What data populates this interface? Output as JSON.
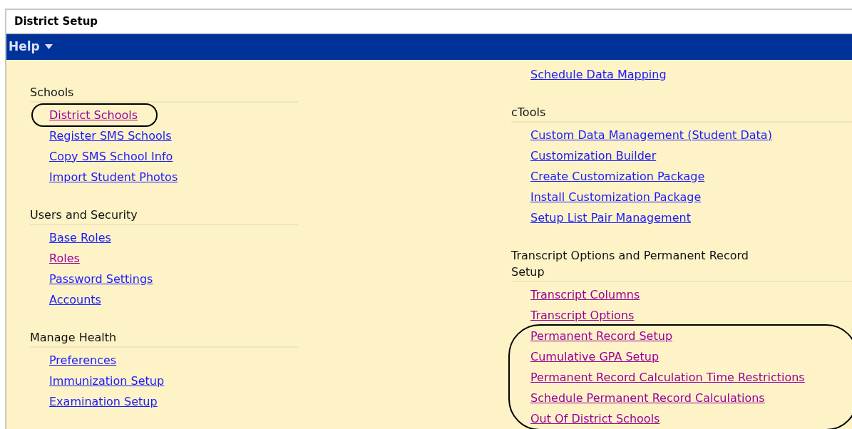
{
  "window": {
    "title": "District Setup"
  },
  "menu_bar": {
    "items": [
      {
        "label": "Help",
        "has_dropdown": true
      }
    ]
  },
  "columns": [
    {
      "sections": [
        {
          "title": "Schools",
          "items": [
            {
              "kind": "circled",
              "links": [
                {
                  "label": "District Schools",
                  "visited": true
                }
              ]
            },
            {
              "kind": "link",
              "label": "Register SMS Schools",
              "visited": false
            },
            {
              "kind": "link",
              "label": "Copy SMS School Info",
              "visited": false
            },
            {
              "kind": "link",
              "label": "Import Student Photos",
              "visited": false
            }
          ]
        },
        {
          "title": "Users and Security",
          "items": [
            {
              "kind": "link",
              "label": "Base Roles",
              "visited": false
            },
            {
              "kind": "link",
              "label": "Roles",
              "visited": true
            },
            {
              "kind": "link",
              "label": "Password Settings",
              "visited": false
            },
            {
              "kind": "link",
              "label": "Accounts",
              "visited": false
            }
          ]
        },
        {
          "title": "Manage Health",
          "items": [
            {
              "kind": "link",
              "label": "Preferences",
              "visited": false
            },
            {
              "kind": "link",
              "label": "Immunization Setup",
              "visited": false
            },
            {
              "kind": "link",
              "label": "Examination Setup",
              "visited": false
            }
          ]
        }
      ]
    },
    {
      "sections": [
        {
          "items": [
            {
              "kind": "link",
              "label": "Schedule Data Mapping",
              "visited": false
            }
          ]
        },
        {
          "title": "cTools",
          "items": [
            {
              "kind": "link",
              "label": "Custom Data Management (Student Data)",
              "visited": false
            },
            {
              "kind": "link",
              "label": "Customization Builder",
              "visited": false
            },
            {
              "kind": "link",
              "label": "Create Customization Package",
              "visited": false
            },
            {
              "kind": "link",
              "label": "Install Customization Package",
              "visited": false
            },
            {
              "kind": "link",
              "label": "Setup List Pair Management",
              "visited": false
            }
          ]
        },
        {
          "title": "Transcript Options and Permanent Record Setup",
          "items": [
            {
              "kind": "link",
              "label": "Transcript Columns",
              "visited": true
            },
            {
              "kind": "link",
              "label": "Transcript Options",
              "visited": true
            },
            {
              "kind": "circled",
              "links": [
                {
                  "label": "Permanent Record Setup",
                  "visited": true
                },
                {
                  "label": "Cumulative GPA Setup",
                  "visited": true
                },
                {
                  "label": "Permanent Record Calculation Time Restrictions",
                  "visited": true
                },
                {
                  "label": "Schedule Permanent Record Calculations",
                  "visited": true
                },
                {
                  "label": "Out Of District Schools",
                  "visited": true
                }
              ]
            }
          ]
        }
      ]
    }
  ]
}
